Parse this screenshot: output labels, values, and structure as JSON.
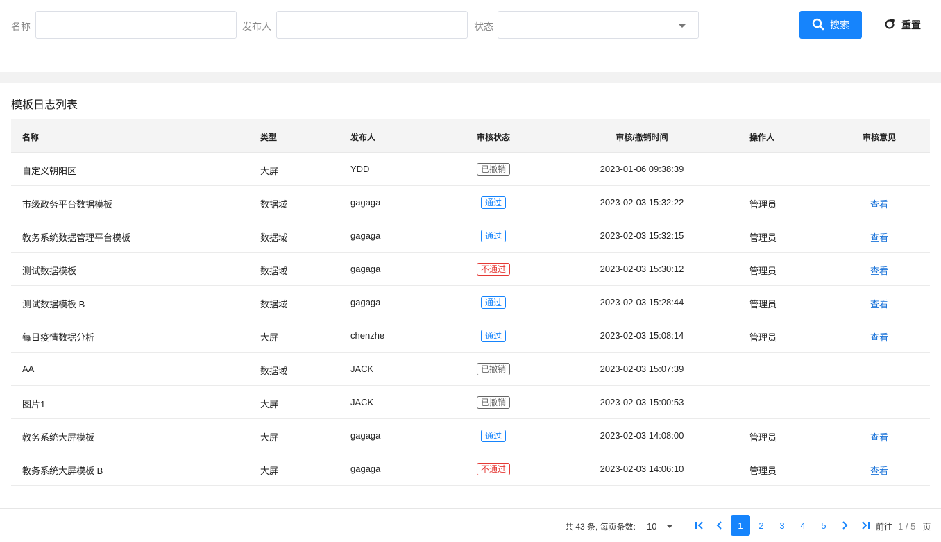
{
  "filters": {
    "name_label": "名称",
    "publisher_label": "发布人",
    "status_label": "状态",
    "name_value": "",
    "publisher_value": "",
    "status_value": "",
    "search_label": "搜索",
    "reset_label": "重置"
  },
  "colors": {
    "accent": "#1684fc",
    "pass": "#1684fc",
    "fail": "#e53935",
    "revoked": "#666666",
    "link": "#1a73d9"
  },
  "table": {
    "title": "模板日志列表",
    "columns": [
      "名称",
      "类型",
      "发布人",
      "审核状态",
      "审核/撤销时间",
      "操作人",
      "审核意见"
    ],
    "view_label": "查看",
    "rows": [
      {
        "name": "自定义朝阳区",
        "type": "大屏",
        "publisher": "YDD",
        "status": "已撤销",
        "status_kind": "revoked",
        "time": "2023-01-06 09:38:39",
        "operator": "",
        "view": ""
      },
      {
        "name": "市级政务平台数据模板",
        "type": "数据域",
        "publisher": "gagaga",
        "status": "通过",
        "status_kind": "pass",
        "time": "2023-02-03 15:32:22",
        "operator": "管理员",
        "view": "查看"
      },
      {
        "name": "教务系统数据管理平台模板",
        "type": "数据域",
        "publisher": "gagaga",
        "status": "通过",
        "status_kind": "pass",
        "time": "2023-02-03 15:32:15",
        "operator": "管理员",
        "view": "查看"
      },
      {
        "name": "测试数据模板",
        "type": "数据域",
        "publisher": "gagaga",
        "status": "不通过",
        "status_kind": "fail",
        "time": "2023-02-03 15:30:12",
        "operator": "管理员",
        "view": "查看"
      },
      {
        "name": "测试数据模板 B",
        "type": "数据域",
        "publisher": "gagaga",
        "status": "通过",
        "status_kind": "pass",
        "time": "2023-02-03 15:28:44",
        "operator": "管理员",
        "view": "查看"
      },
      {
        "name": "每日疫情数据分析",
        "type": "大屏",
        "publisher": "chenzhe",
        "status": "通过",
        "status_kind": "pass",
        "time": "2023-02-03 15:08:14",
        "operator": "管理员",
        "view": "查看"
      },
      {
        "name": "AA",
        "type": "数据域",
        "publisher": "JACK",
        "status": "已撤销",
        "status_kind": "revoked",
        "time": "2023-02-03 15:07:39",
        "operator": "",
        "view": ""
      },
      {
        "name": "图片1",
        "type": "大屏",
        "publisher": "JACK",
        "status": "已撤销",
        "status_kind": "revoked",
        "time": "2023-02-03 15:00:53",
        "operator": "",
        "view": ""
      },
      {
        "name": "教务系统大屏模板",
        "type": "大屏",
        "publisher": "gagaga",
        "status": "通过",
        "status_kind": "pass",
        "time": "2023-02-03 14:08:00",
        "operator": "管理员",
        "view": "查看"
      },
      {
        "name": "教务系统大屏模板 B",
        "type": "大屏",
        "publisher": "gagaga",
        "status": "不通过",
        "status_kind": "fail",
        "time": "2023-02-03 14:06:10",
        "operator": "管理员",
        "view": "查看"
      }
    ]
  },
  "pagination": {
    "summary": "共 43 条, 每页条数:",
    "page_size": "10",
    "pages": [
      "1",
      "2",
      "3",
      "4",
      "5"
    ],
    "current_page": "1",
    "goto_label": "前往",
    "page_info": "1 / 5",
    "page_unit": "页",
    "icons": [
      "first-page-icon",
      "prev-page-icon",
      "next-page-icon",
      "last-page-icon"
    ]
  }
}
